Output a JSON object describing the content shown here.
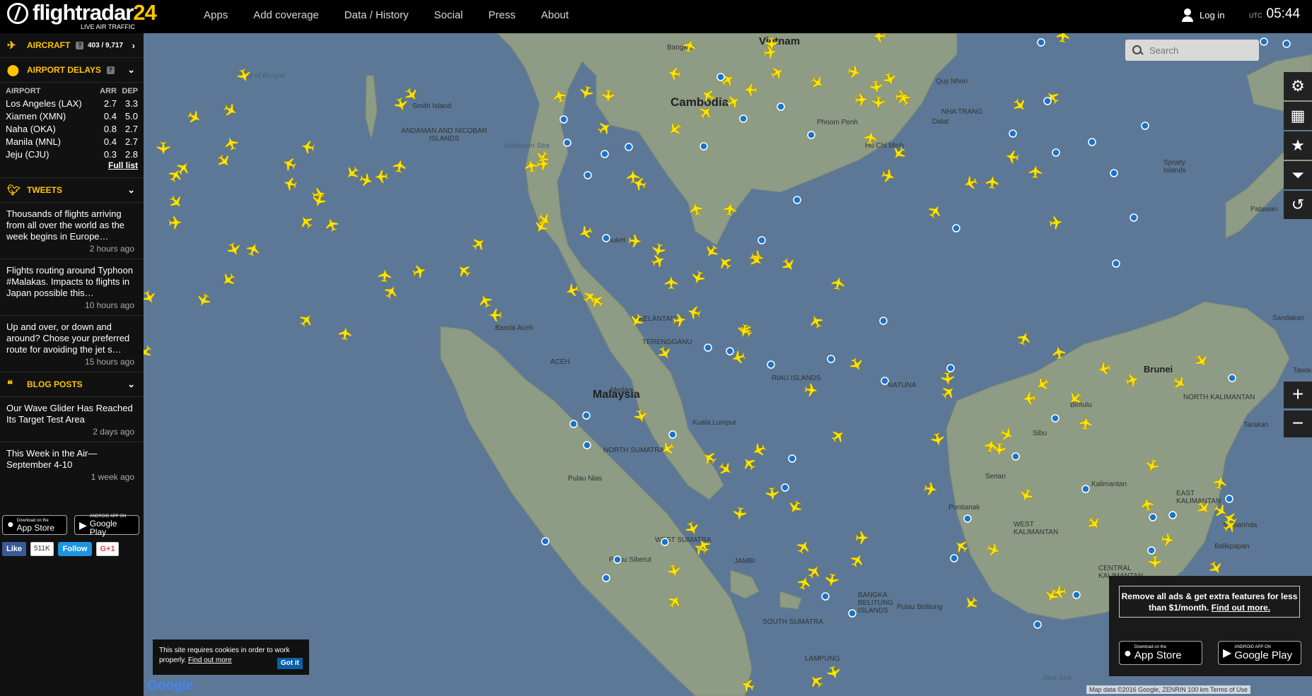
{
  "brand": {
    "name_a": "flightradar",
    "name_b": "24",
    "tagline": "LIVE AIR TRAFFIC"
  },
  "nav": [
    "Apps",
    "Add coverage",
    "Data / History",
    "Social",
    "Press",
    "About"
  ],
  "header": {
    "login": "Log in",
    "utc_label": "UTC",
    "time": "05:44"
  },
  "sidebar": {
    "aircraft": {
      "label": "AIRCRAFT",
      "help": "?",
      "count": "403 / 9,717"
    },
    "delays": {
      "label": "AIRPORT DELAYS",
      "help": "?",
      "col_airport": "AIRPORT",
      "col_arr": "ARR",
      "col_dep": "DEP",
      "rows": [
        {
          "airport": "Los Angeles (LAX)",
          "arr": "2.7",
          "dep": "3.3"
        },
        {
          "airport": "Xiamen (XMN)",
          "arr": "0.4",
          "dep": "5.0"
        },
        {
          "airport": "Naha (OKA)",
          "arr": "0.8",
          "dep": "2.7"
        },
        {
          "airport": "Manila (MNL)",
          "arr": "0.4",
          "dep": "2.7"
        },
        {
          "airport": "Jeju (CJU)",
          "arr": "0.3",
          "dep": "2.8"
        }
      ],
      "full_list": "Full list"
    },
    "tweets": {
      "label": "TWEETS",
      "items": [
        {
          "text": "Thousands of flights arriving from all over the world as the week begins in Europe…",
          "ago": "2 hours ago"
        },
        {
          "text": "Flights routing around Typhoon #Malakas. Impacts to flights in Japan possible this…",
          "ago": "10 hours ago"
        },
        {
          "text": "Up and over, or down and around? Chose your preferred route for avoiding the jet s…",
          "ago": "15 hours ago"
        }
      ]
    },
    "blog": {
      "label": "BLOG POSTS",
      "items": [
        {
          "text": "Our Wave Glider Has Reached Its Target Test Area",
          "ago": "2 days ago"
        },
        {
          "text": "This Week in the Air—September 4-10",
          "ago": "1 week ago"
        }
      ]
    },
    "appstore": {
      "small": "Download on the",
      "big": "App Store"
    },
    "googleplay": {
      "small": "ANDROID APP ON",
      "big": "Google Play"
    },
    "social": {
      "like": "Like",
      "like_count": "511K",
      "follow": "Follow",
      "gplus": "G+1"
    }
  },
  "search": {
    "placeholder": "Search"
  },
  "map_labels": {
    "vietnam": "Vietnam",
    "cambodia": "Cambodia",
    "malaysia": "Malaysia",
    "bay": "Bay of Bengal",
    "andaman_sea": "Andaman Sea",
    "andaman_islands": "ANDAMAN AND NICOBAR ISLANDS",
    "smith": "Smith Island",
    "brunei": "Brunei",
    "spratly": "Spratly Islands",
    "kalimantan": "Kalimantan",
    "sumatra": "NORTH SUMATRA",
    "west_sumatra": "WEST SUMATRA",
    "java_sea": "Java Sea",
    "pontianak": "Pontianak",
    "medan": "Medan",
    "aceh": "ACEH",
    "banda_aceh": "Banda Aceh",
    "kuala_lumpur": "Kuala Lumpur",
    "ho_chi_minh": "Ho Chi Minh",
    "phuket": "Phuket",
    "nias": "Pulau Nias",
    "siberut": "Pulau Siberut",
    "jambi": "JAMBI",
    "bangka": "BANGKA BELITUNG ISLANDS",
    "south_sumatra": "SOUTH SUMATRA",
    "lampung": "LAMPUNG",
    "palawan": "Palawan",
    "bangkok": "Bangkok",
    "quy_nhon": "Quy Nhon",
    "nha_trang": "NHA TRANG",
    "dalat": "Dalat",
    "phnom_penh": "Phnom Penh",
    "tawau": "Tawau",
    "sandakan": "Sandakan",
    "tarakan": "Tarakan",
    "samarinda": "Samarinda",
    "balikpapan": "Balikpapan",
    "bintulu": "Bintulu",
    "sibu": "Sibu",
    "serian": "Serian",
    "north_kalimantan": "NORTH KALIMANTAN",
    "west_kalimantan": "WEST KALIMANTAN",
    "central_kalimantan": "CENTRAL KALIMANTAN",
    "east_kalimantan": "EAST KALIMANTAN",
    "belitung": "Pulau Belitung",
    "riau_islands": "RIAU ISLANDS",
    "natuna": "NATUNA",
    "terengganu": "TERENGGANU",
    "kelantan": "KELANTAN"
  },
  "promo": {
    "text": "Remove all ads & get extra features for less than $1/month.",
    "link": "Find out more."
  },
  "cookie": {
    "text": "This site requires cookies in order to work properly.",
    "link": "Find out more",
    "button": "Got it"
  },
  "google": "Google",
  "attribution": "Map data ©2016 Google, ZENRIN   100 km         Terms of Use",
  "colors": {
    "accent": "#ffc400",
    "sea": "#5c7896",
    "land": "#8f9a86",
    "plane": "#ffe600",
    "pin": "#1a73c8"
  }
}
